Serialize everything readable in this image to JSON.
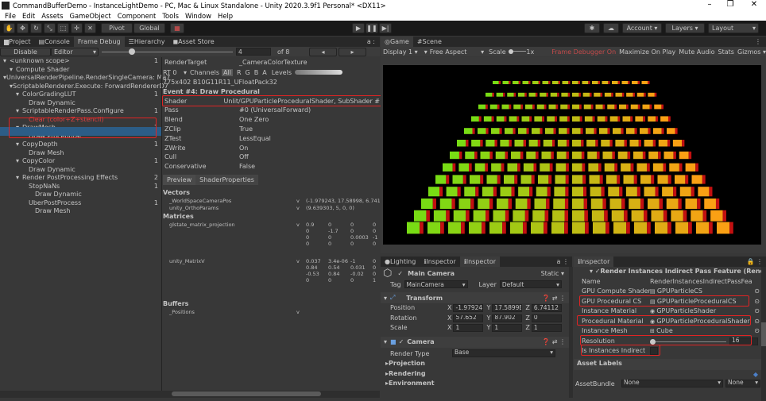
{
  "window": {
    "title": "CommandBufferDemo - InstanceLightDemo - PC, Mac & Linux Standalone - Unity 2020.3.9f1 Personal* <DX11>",
    "min": "–",
    "max": "❐",
    "close": "✕"
  },
  "menu": [
    "File",
    "Edit",
    "Assets",
    "GameObject",
    "Component",
    "Tools",
    "Window",
    "Help"
  ],
  "toolbar": {
    "pivot": "Pivot",
    "global": "Global",
    "account": "Account ▾",
    "layers": "Layers ▾",
    "layout": "Layout"
  },
  "tabs_left": [
    "Project",
    "Console",
    "Frame Debug",
    "Hierarchy",
    "Asset Store"
  ],
  "frame_debug": {
    "disable": "Disable",
    "editor": "Editor",
    "event_num": "4",
    "of_total": "of 8",
    "tree": [
      {
        "t": "<unknown scope>",
        "n": "1",
        "d": 0
      },
      {
        "t": "Compute Shader",
        "n": "",
        "d": 1
      },
      {
        "t": "UniversalRenderPipeline.RenderSingleCamera: Ma",
        "n": "7",
        "d": 0
      },
      {
        "t": "ScriptableRenderer.Execute: ForwardRendererD",
        "n": "7",
        "d": 1
      },
      {
        "t": "ColorGradingLUT",
        "n": "1",
        "d": 2
      },
      {
        "t": "Draw Dynamic",
        "n": "",
        "d": 3
      },
      {
        "t": "ScriptableRenderPass.Configure",
        "n": "1",
        "d": 2
      },
      {
        "t": "Clear (color+Z+stencil)",
        "n": "",
        "d": 3
      },
      {
        "t": "DrawMesh",
        "n": "1",
        "d": 2
      },
      {
        "t": "Draw Procedural",
        "n": "",
        "d": 3
      },
      {
        "t": "CopyDepth",
        "n": "1",
        "d": 2
      },
      {
        "t": "Draw Mesh",
        "n": "",
        "d": 3
      },
      {
        "t": "CopyColor",
        "n": "1",
        "d": 2
      },
      {
        "t": "Draw Dynamic",
        "n": "",
        "d": 3
      },
      {
        "t": "Render PostProcessing Effects",
        "n": "2",
        "d": 2
      },
      {
        "t": "StopNaNs",
        "n": "1",
        "d": 3
      },
      {
        "t": "Draw Dynamic",
        "n": "",
        "d": 4
      },
      {
        "t": "UberPostProcess",
        "n": "1",
        "d": 3
      },
      {
        "t": "Draw Mesh",
        "n": "",
        "d": 4
      }
    ],
    "render_target_k": "RenderTarget",
    "render_target_v": "_CameraColorTexture",
    "rt": "RT 0",
    "channels": "Channels",
    "ch_all": "All",
    "ch_r": "R",
    "ch_g": "G",
    "ch_b": "B",
    "ch_a": "A",
    "levels": "Levels",
    "fmt": "775x402 B10G11R11_UFloatPack32",
    "event": "Event #4: Draw Procedural",
    "props": [
      [
        "Shader",
        "Unlit/GPUParticleProceduralShader, SubShader #"
      ],
      [
        "Pass",
        "#0 (UniversalForward)"
      ],
      [
        "Blend",
        "One Zero"
      ],
      [
        "ZClip",
        "True"
      ],
      [
        "ZTest",
        "LessEqual"
      ],
      [
        "ZWrite",
        "On"
      ],
      [
        "Cull",
        "Off"
      ],
      [
        "Conservative",
        "False"
      ]
    ],
    "preview": "Preview",
    "shaderprops": "ShaderProperties",
    "vectors": "Vectors",
    "vec_rows": [
      [
        "_WorldSpaceCameraPos",
        "v",
        "(-1.979243, 17.58998, 6.741"
      ],
      [
        "unity_OrthoParams",
        "v",
        "(9.639303, 5, 0, 0)"
      ]
    ],
    "matrices": "Matrices",
    "m1": "glstate_matrix_projection",
    "m1v": "v",
    "m1c": [
      [
        "0.9",
        "0",
        "0",
        "0"
      ],
      [
        "0",
        "-1.7",
        "0",
        "0"
      ],
      [
        "0",
        "0",
        "0.0003",
        "0"
      ],
      [
        "0",
        "0",
        "-1",
        "0"
      ]
    ],
    "m2": "unity_MatrixV",
    "m2v": "v",
    "m2c": [
      [
        "0.037",
        "0.84",
        "-0.53",
        "0"
      ],
      [
        "3.4e-06",
        "0.54",
        "0.84",
        "0"
      ],
      [
        "-1",
        "0.031",
        "-0.02",
        "0"
      ],
      [
        "0",
        "0",
        "0",
        "1"
      ]
    ],
    "buffers": "Buffers",
    "b1": "_Positions",
    "b1v": "v"
  },
  "game": {
    "tab_game": "Game",
    "tab_scene": "Scene",
    "display": "Display 1 ▾",
    "aspect": "Free Aspect",
    "scale": "Scale",
    "scale_v": "1x",
    "fd_on": "Frame Debugger On",
    "max": "Maximize On Play",
    "mute": "Mute Audio",
    "stats": "Stats",
    "gizmos": "Gizmos ▾"
  },
  "inspector1": {
    "tabs": [
      "Lighting",
      "Inspector",
      "Inspector"
    ],
    "name": "Main Camera",
    "static": "Static ▾",
    "tag_k": "Tag",
    "tag_v": "MainCamera",
    "layer_k": "Layer",
    "layer_v": "Default",
    "transform": "Transform",
    "pos": "Position",
    "rot": "Rotation",
    "scale": "Scale",
    "px": "-1.97924",
    "py": "17.5899E",
    "pz": "6.74112",
    "rx": "57.652",
    "ry": "87.902",
    "rz": "0",
    "sx": "1",
    "sy": "1",
    "sz": "1",
    "camera": "Camera",
    "rtype": "Render Type",
    "rtype_v": "Base",
    "projection": "Projection",
    "rendering": "Rendering",
    "environment": "Environment"
  },
  "inspector2": {
    "tab": "Inspector",
    "header": "Render Instances Indirect Pass Feature (Rende",
    "rows": [
      [
        "Name",
        "RenderInstancesIndirectPassFeature"
      ],
      [
        "GPU Compute Shader",
        "GPUParticleCS"
      ],
      [
        "GPU Procedural CS",
        "GPUParticleProceduralCS"
      ],
      [
        "Instance Material",
        "GPUParticleShader"
      ],
      [
        "Procedural Material",
        "GPUParticleProceduralShader"
      ],
      [
        "Instance Mesh",
        "Cube"
      ]
    ],
    "resolution": "Resolution",
    "resolution_v": "16",
    "resolution_frac": 0.0,
    "indirect": "Is Instances Indirect",
    "asset_labels": "Asset Labels",
    "asset_bundle": "AssetBundle",
    "bundle_v": "None",
    "bundle_v2": "None"
  },
  "colors": {
    "red": "#e02424",
    "select": "#2c5d87",
    "accent": "#4c7fc7"
  }
}
